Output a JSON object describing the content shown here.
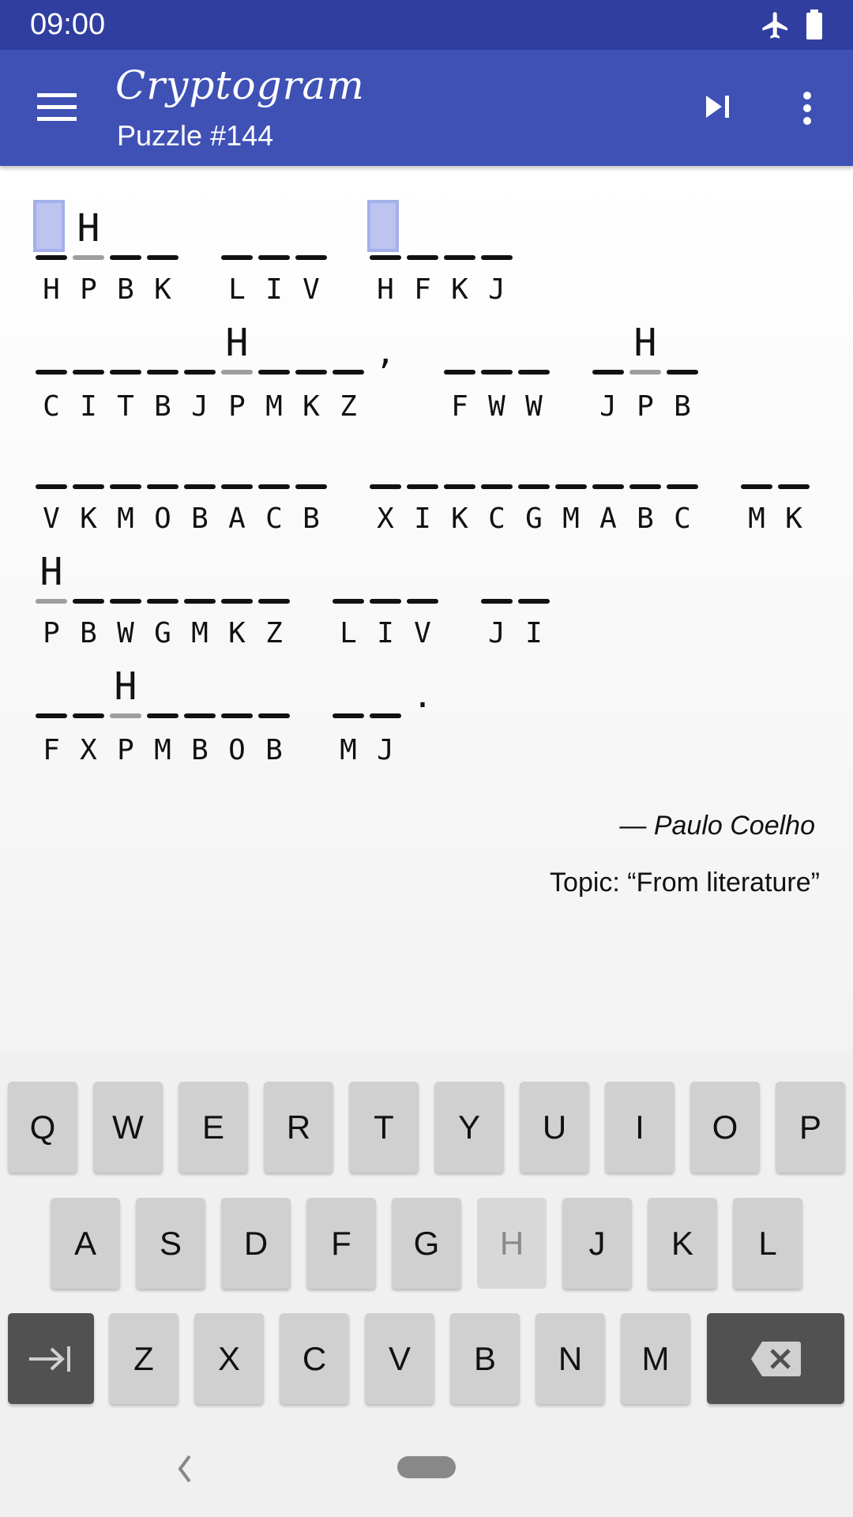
{
  "status": {
    "time": "09:00",
    "icons": [
      "airplane-icon",
      "battery-icon"
    ]
  },
  "appbar": {
    "title": "Cryptogram",
    "subtitle": "Puzzle #144",
    "icons": [
      "menu-icon",
      "skip-next-icon",
      "more-vert-icon"
    ]
  },
  "puzzle": {
    "rows": [
      "HPBK LIV HFKJ",
      "CITBJPMKZ, FWW JPB",
      "VKMOBACB XIKCGMABC MK",
      "PBWGMKZ LIV JI",
      "FXPMBOB MJ."
    ],
    "mapping": {
      "P": "H"
    },
    "selected": "H",
    "colors": {
      "selected": "#bcc4ef",
      "solved_underline": "#9e9e9e",
      "accent": "#3f51b5"
    }
  },
  "author": "— Paulo Coelho",
  "topic": "Topic: “From literature”",
  "keyboard": {
    "rows": [
      [
        "Q",
        "W",
        "E",
        "R",
        "T",
        "Y",
        "U",
        "I",
        "O",
        "P"
      ],
      [
        "A",
        "S",
        "D",
        "F",
        "G",
        "H",
        "J",
        "K",
        "L"
      ],
      [
        "Z",
        "X",
        "C",
        "V",
        "B",
        "N",
        "M"
      ]
    ],
    "disabled": [
      "H"
    ],
    "special": [
      "tab-next-icon",
      "backspace-icon"
    ]
  },
  "navbar": {
    "icons": [
      "back-icon",
      "home-pill-icon"
    ]
  }
}
